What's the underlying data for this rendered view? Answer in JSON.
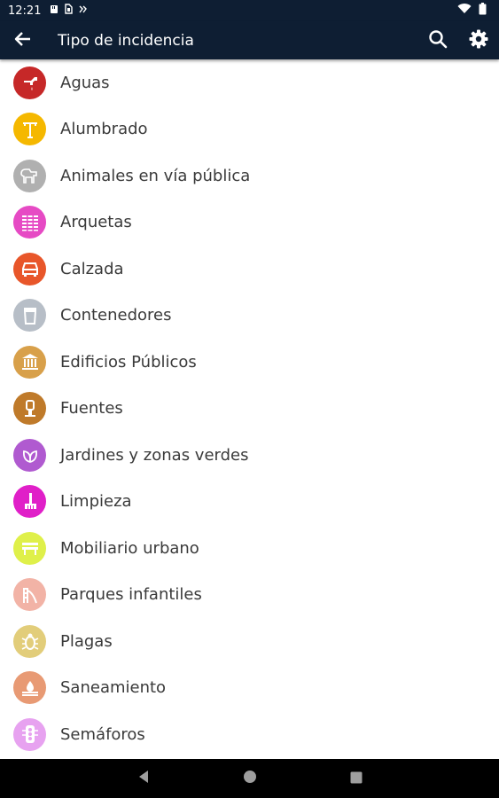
{
  "status_bar": {
    "time": "12:21",
    "icons": [
      "card-icon",
      "sim-icon",
      "nfc-icon",
      "wifi-icon",
      "battery-icon"
    ]
  },
  "app_bar": {
    "title": "Tipo de incidencia",
    "background": "#0e1e33",
    "icons": [
      "back-arrow-icon",
      "search-icon",
      "settings-gear-icon"
    ]
  },
  "categories": [
    {
      "label": "Aguas",
      "color": "#c62828",
      "icon": "faucet-icon"
    },
    {
      "label": "Alumbrado",
      "color": "#f5b800",
      "icon": "streetlight-icon"
    },
    {
      "label": "Animales en vía pública",
      "color": "#b0b0b0",
      "icon": "dog-icon"
    },
    {
      "label": "Arquetas",
      "color": "#e64ac4",
      "icon": "grate-icon"
    },
    {
      "label": "Calzada",
      "color": "#e8562a",
      "icon": "car-icon"
    },
    {
      "label": "Contenedores",
      "color": "#b7bec7",
      "icon": "bin-icon"
    },
    {
      "label": "Edificios Públicos",
      "color": "#d8a04a",
      "icon": "building-icon"
    },
    {
      "label": "Fuentes",
      "color": "#bf7a2a",
      "icon": "fountain-icon"
    },
    {
      "label": "Jardines y zonas verdes",
      "color": "#b05ad0",
      "icon": "leaf-icon"
    },
    {
      "label": "Limpieza",
      "color": "#e01fc8",
      "icon": "broom-icon"
    },
    {
      "label": "Mobiliario urbano",
      "color": "#dff04a",
      "icon": "bench-icon"
    },
    {
      "label": "Parques infantiles",
      "color": "#f2b3a6",
      "icon": "slide-icon"
    },
    {
      "label": "Plagas",
      "color": "#e2cd7a",
      "icon": "bug-icon"
    },
    {
      "label": "Saneamiento",
      "color": "#e89a74",
      "icon": "drain-icon"
    },
    {
      "label": "Semáforos",
      "color": "#e7a2f0",
      "icon": "traffic-light-icon"
    }
  ],
  "nav_bar": {
    "icons": [
      "nav-back-icon",
      "nav-home-icon",
      "nav-recents-icon"
    ]
  }
}
